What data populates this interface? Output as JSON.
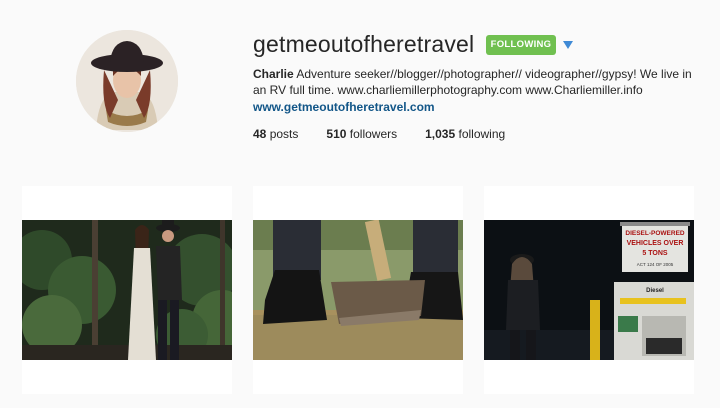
{
  "profile": {
    "username": "getmeoutofheretravel",
    "follow_button": "FOLLOWING",
    "bio_name": "Charlie",
    "bio_text": "Adventure seeker//blogger//photographer// videographer//gypsy! We live in an RV full time. www.charliemillerphotography.com www.Charliemiller.info",
    "website": "www.getmeoutofheretravel.com"
  },
  "stats": {
    "posts_count": "48",
    "posts_label": "posts",
    "followers_count": "510",
    "followers_label": "followers",
    "following_count": "1,035",
    "following_label": "following"
  },
  "photo3": {
    "sign_line1": "DIESEL-POWERED",
    "sign_line2": "VEHICLES OVER",
    "sign_line3": "5 TONS",
    "sign_line4": "ACT 124 OF 2005",
    "pump_label": "Diesel"
  },
  "colors": {
    "follow_green": "#70c050",
    "link_blue": "#125688",
    "caret_blue": "#3f8ad6",
    "background": "#fafafa"
  }
}
